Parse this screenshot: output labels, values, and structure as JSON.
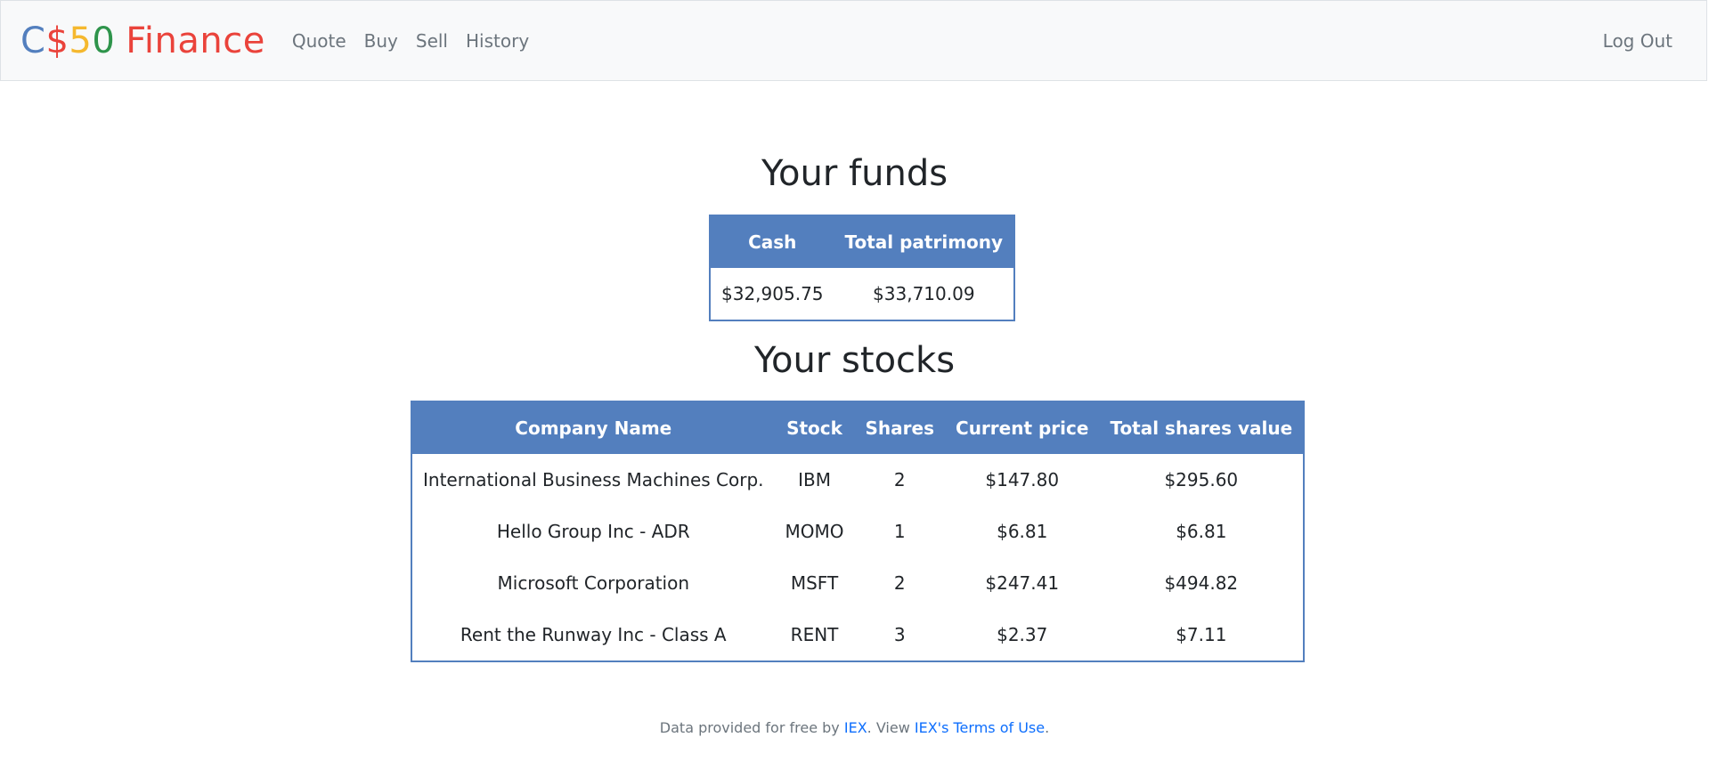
{
  "brand": {
    "c": "C",
    "dollar": "$",
    "five": "5",
    "zero": "0",
    "finance": "Finance"
  },
  "nav": {
    "items": [
      {
        "label": "Quote"
      },
      {
        "label": "Buy"
      },
      {
        "label": "Sell"
      },
      {
        "label": "History"
      }
    ],
    "logout": "Log Out"
  },
  "funds": {
    "title": "Your funds",
    "headers": [
      "Cash",
      "Total patrimony"
    ],
    "row": [
      "$32,905.75",
      "$33,710.09"
    ]
  },
  "stocks": {
    "title": "Your stocks",
    "headers": [
      "Company Name",
      "Stock",
      "Shares",
      "Current price",
      "Total shares value"
    ],
    "rows": [
      [
        "International Business Machines Corp.",
        "IBM",
        "2",
        "$147.80",
        "$295.60"
      ],
      [
        "Hello Group Inc - ADR",
        "MOMO",
        "1",
        "$6.81",
        "$6.81"
      ],
      [
        "Microsoft Corporation",
        "MSFT",
        "2",
        "$247.41",
        "$494.82"
      ],
      [
        "Rent the Runway Inc - Class A",
        "RENT",
        "3",
        "$2.37",
        "$7.11"
      ]
    ]
  },
  "footer": {
    "prefix": "Data provided for free by",
    "iex_link": "IEX",
    "middle": ". View",
    "terms_link": "IEX's Terms of Use",
    "suffix": "."
  },
  "colors": {
    "accent": "#537fbe",
    "brand_blue": "#537fbe",
    "brand_red": "#ea433b",
    "brand_yellow": "#f5b82e",
    "brand_green": "#2e944b",
    "link": "#0d6efd"
  }
}
